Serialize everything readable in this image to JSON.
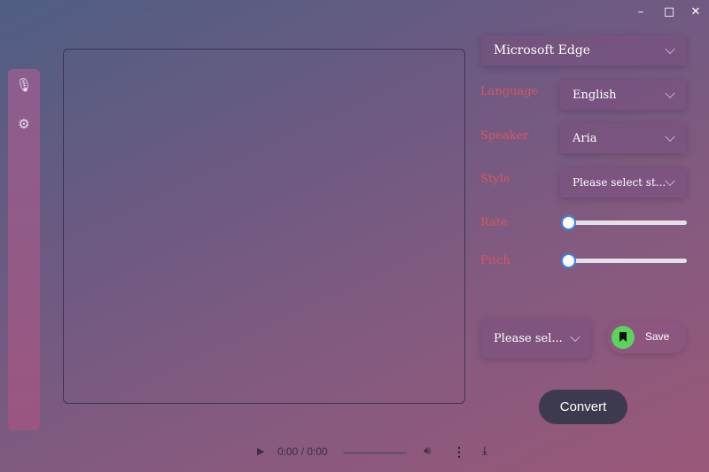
{
  "window": {
    "minimize_icon": "minimize-icon",
    "maximize_icon": "maximize-icon",
    "close_icon": "close-icon"
  },
  "sidebar": {
    "items": [
      {
        "icon": "microphone-icon"
      },
      {
        "icon": "gear-icon"
      }
    ]
  },
  "engine": {
    "value": "Microsoft Edge"
  },
  "language": {
    "label": "Language",
    "value": "English"
  },
  "speaker": {
    "label": "Speaker",
    "value": "Aria"
  },
  "style": {
    "label": "Style",
    "value": "Please select st..."
  },
  "rate": {
    "label": "Rate",
    "value": 0
  },
  "pitch": {
    "label": "Pitch",
    "value": 0
  },
  "format": {
    "value": "Please sel..."
  },
  "save": {
    "label": "Save",
    "icon": "bookmark-icon",
    "color": "#5cd35c"
  },
  "convert": {
    "label": "Convert"
  },
  "player": {
    "time": "0:00 / 0:00",
    "progress": 0
  }
}
